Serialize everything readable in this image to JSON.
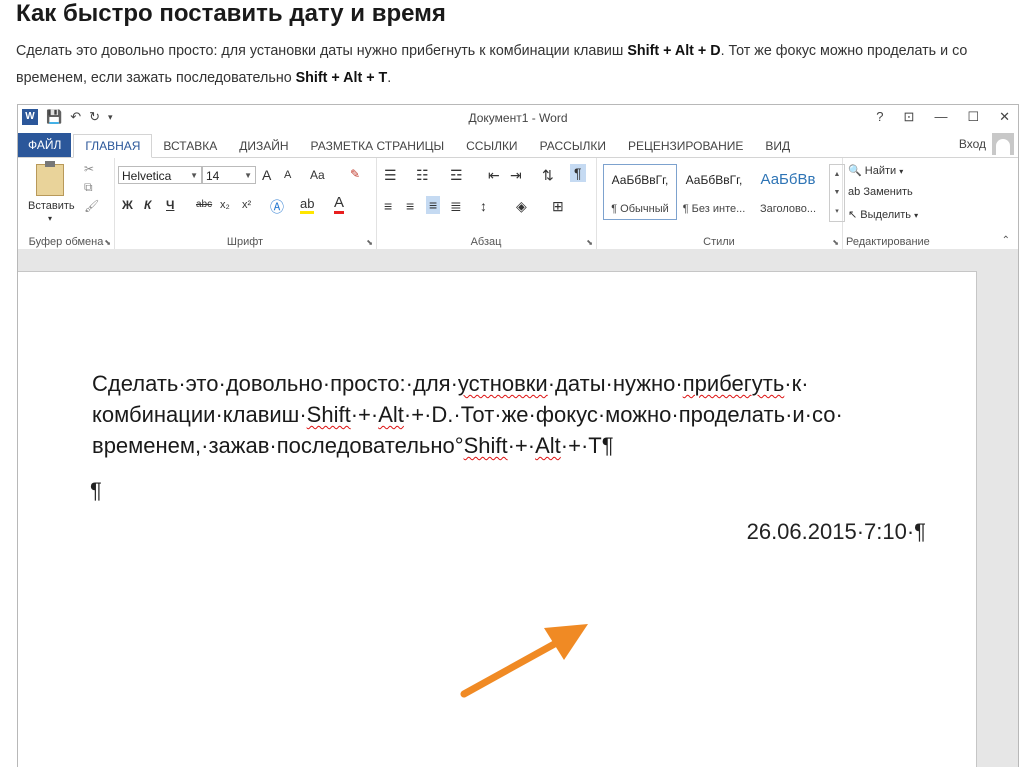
{
  "article": {
    "title": "Как быстро поставить дату и время",
    "p1": "Сделать это довольно просто: для установки даты нужно прибегнуть к комбинации клавиш ",
    "k1": "Shift + Alt + D",
    "p2": ". Тот же фокус можно проделать и со временем, если зажать последовательно ",
    "k2": "Shift + Alt + T",
    "p3": "."
  },
  "window": {
    "title": "Документ1 - Word",
    "logo": "W",
    "help": "?",
    "restore": "⊡",
    "minimize": "—",
    "maximize": "☐",
    "close": "✕",
    "signin": "Вход"
  },
  "tabs": [
    "ФАЙЛ",
    "ГЛАВНАЯ",
    "ВСТАВКА",
    "ДИЗАЙН",
    "РАЗМЕТКА СТРАНИЦЫ",
    "ССЫЛКИ",
    "РАССЫЛКИ",
    "РЕЦЕНЗИРОВАНИЕ",
    "ВИД"
  ],
  "ribbon": {
    "clipboard": {
      "label": "Буфер обмена",
      "paste": "Вставить"
    },
    "font": {
      "label": "Шрифт",
      "name": "Helvetica",
      "size": "14",
      "bold": "Ж",
      "italic": "К",
      "underline": "Ч",
      "strike": "abc",
      "sub": "x₂",
      "sup": "x²",
      "grow": "A",
      "shrink": "A",
      "case": "Aa"
    },
    "paragraph": {
      "label": "Абзац",
      "pilcrow": "¶"
    },
    "styles": {
      "label": "Стили",
      "items": [
        {
          "sample": "АаБбВвГг,",
          "name": "¶ Обычный"
        },
        {
          "sample": "АаБбВвГг,",
          "name": "¶ Без инте..."
        },
        {
          "sample": "АаБбВв",
          "name": "Заголово..."
        }
      ]
    },
    "editing": {
      "label": "Редактирование",
      "find": "Найти",
      "replace": "Заменить",
      "select": "Выделить"
    }
  },
  "document": {
    "line1_a": "Сделать·это·довольно·просто:·для·",
    "line1_err1": "устновки",
    "line1_b": "·даты·нужно·",
    "line1_err2": "прибегуть",
    "line1_c": "·к·",
    "line2_a": "комбинации·клавиш·",
    "line2_shift": "Shift",
    "line2_b": "·+·",
    "line2_alt": "Alt",
    "line2_c": "·+·D.·Тот·же·фокус·можно·проделать·и·со·",
    "line3_a": "временем,·зажав·последовательно°",
    "line3_shift": "Shift",
    "line3_b": "·+·",
    "line3_alt": "Alt",
    "line3_c": "·+·Т¶",
    "empty_para": "¶",
    "datetime": "26.06.2015·7:10·¶"
  },
  "colors": {
    "accent": "#2b579a",
    "arrow": "#f08a24"
  }
}
